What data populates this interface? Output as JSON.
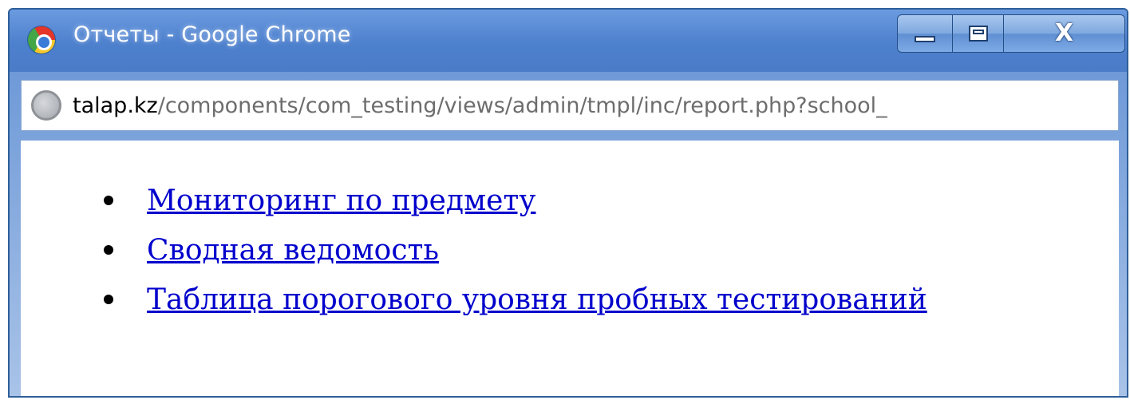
{
  "window": {
    "title": "Отчеты - Google Chrome",
    "controls": {
      "close_label": "X"
    }
  },
  "addressbar": {
    "url_domain": "talap.kz",
    "url_path": "/components/com_testing/views/admin/tmpl/inc/report.php?school_"
  },
  "content": {
    "links": [
      {
        "label": "Мониторинг по предмету"
      },
      {
        "label": "Сводная ведомость"
      },
      {
        "label": "Таблица порогового уровня пробных тестирований"
      }
    ]
  },
  "colors": {
    "link": "#0000cc",
    "titlebar": "#4d80cd",
    "url_path": "#6d6d6d"
  }
}
